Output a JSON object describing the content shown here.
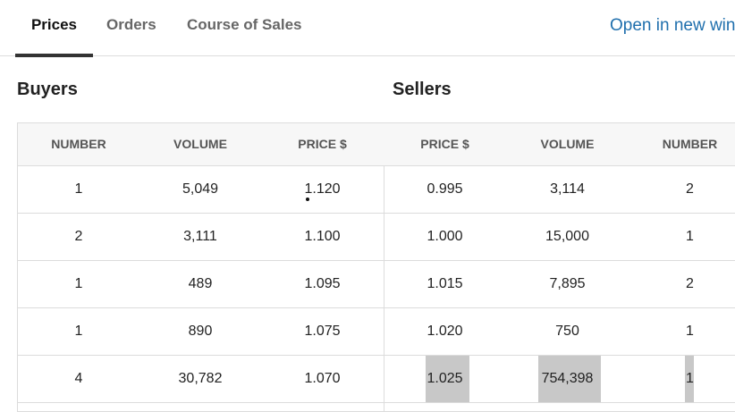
{
  "tabs": [
    {
      "label": "Prices",
      "active": true
    },
    {
      "label": "Orders",
      "active": false
    },
    {
      "label": "Course of Sales",
      "active": false
    }
  ],
  "open_link": "Open in new win",
  "sections": {
    "buyers": "Buyers",
    "sellers": "Sellers"
  },
  "columns": [
    "NUMBER",
    "VOLUME",
    "PRICE $",
    "PRICE $",
    "VOLUME",
    "NUMBER"
  ],
  "rows": [
    {
      "buy_number": "1",
      "buy_volume": "5,049",
      "buy_price": "1.120",
      "sell_price": "0.995",
      "sell_volume": "3,114",
      "sell_number": "2"
    },
    {
      "buy_number": "2",
      "buy_volume": "3,111",
      "buy_price": "1.100",
      "sell_price": "1.000",
      "sell_volume": "15,000",
      "sell_number": "1"
    },
    {
      "buy_number": "1",
      "buy_volume": "489",
      "buy_price": "1.095",
      "sell_price": "1.015",
      "sell_volume": "7,895",
      "sell_number": "2"
    },
    {
      "buy_number": "1",
      "buy_volume": "890",
      "buy_price": "1.075",
      "sell_price": "1.020",
      "sell_volume": "750",
      "sell_number": "1"
    },
    {
      "buy_number": "4",
      "buy_volume": "30,782",
      "buy_price": "1.070",
      "sell_price": "1.025",
      "sell_volume": "754,398",
      "sell_number": "1"
    }
  ],
  "highlight_color": "#c8c8c8",
  "link_color": "#1f6fad"
}
